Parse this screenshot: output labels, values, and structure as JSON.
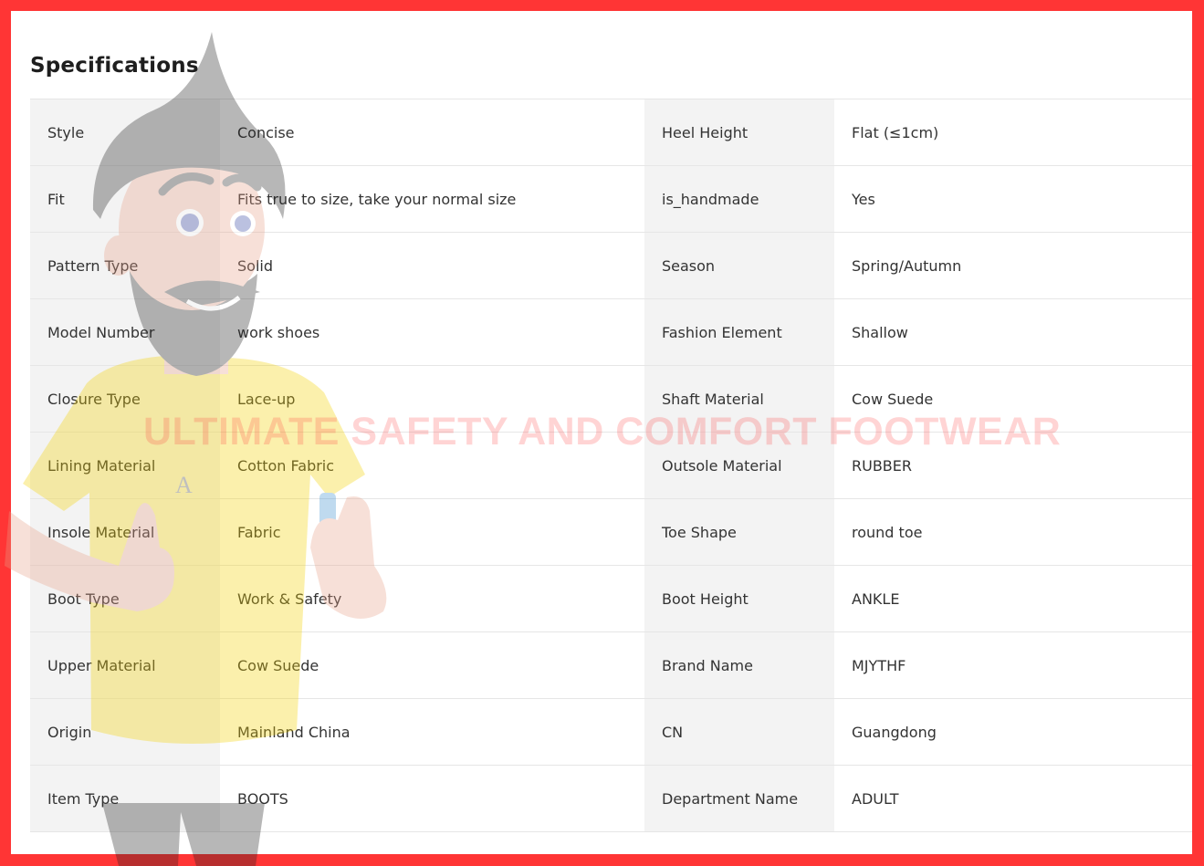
{
  "section": {
    "title": "Specifications"
  },
  "specs": {
    "rows": [
      {
        "left_label": "Style",
        "left_value": "Concise",
        "right_label": "Heel Height",
        "right_value": "Flat (≤1cm)"
      },
      {
        "left_label": "Fit",
        "left_value": "Fits true to size, take your normal size",
        "right_label": "is_handmade",
        "right_value": "Yes"
      },
      {
        "left_label": "Pattern Type",
        "left_value": "Solid",
        "right_label": "Season",
        "right_value": "Spring/Autumn"
      },
      {
        "left_label": "Model Number",
        "left_value": "work shoes",
        "right_label": "Fashion Element",
        "right_value": "Shallow"
      },
      {
        "left_label": "Closure Type",
        "left_value": "Lace-up",
        "right_label": "Shaft Material",
        "right_value": "Cow Suede"
      },
      {
        "left_label": "Lining Material",
        "left_value": "Cotton Fabric",
        "right_label": "Outsole Material",
        "right_value": "RUBBER"
      },
      {
        "left_label": "Insole Material",
        "left_value": "Fabric",
        "right_label": "Toe Shape",
        "right_value": "round toe"
      },
      {
        "left_label": "Boot Type",
        "left_value": "Work & Safety",
        "right_label": "Boot Height",
        "right_value": "ANKLE"
      },
      {
        "left_label": "Upper Material",
        "left_value": "Cow Suede",
        "right_label": "Brand Name",
        "right_value": "MJYTHF"
      },
      {
        "left_label": "Origin",
        "left_value": "Mainland China",
        "right_label": "CN",
        "right_value": "Guangdong"
      },
      {
        "left_label": "Item Type",
        "left_value": "BOOTS",
        "right_label": "Department Name",
        "right_value": "ADULT"
      }
    ]
  },
  "overlay": {
    "watermark_text": "ULTIMATE SAFETY AND COMFORT FOOTWEAR",
    "character": "cartoon-bearded-man-thumbs-up",
    "border_color": "#ff3535"
  }
}
